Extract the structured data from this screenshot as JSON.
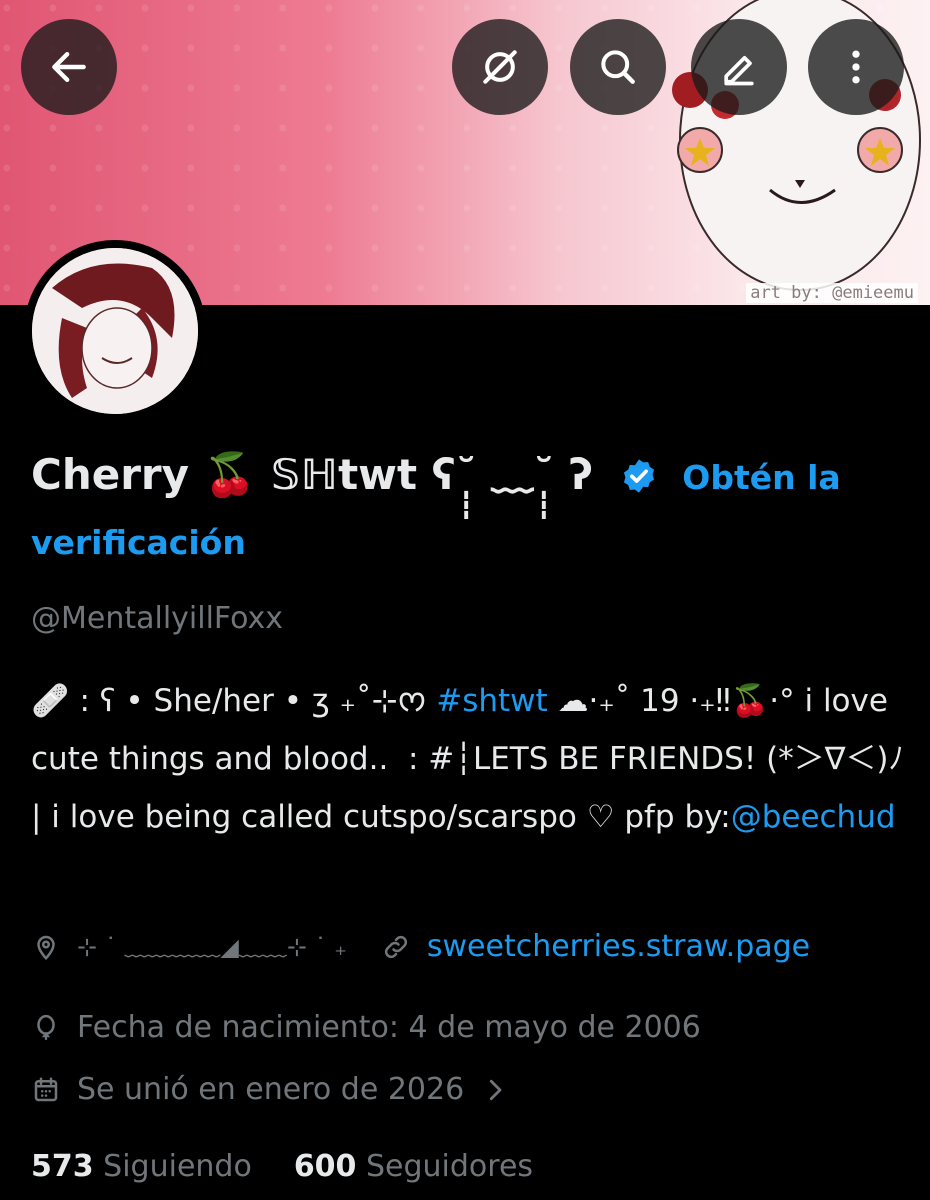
{
  "header": {
    "back_icon": "arrow-left-icon",
    "grok_icon": "slashed-circle-icon",
    "search_icon": "search-icon",
    "edit_icon": "pencil-icon",
    "more_icon": "vertical-ellipsis-icon",
    "banner_credit": "art by: @emieemu"
  },
  "profile": {
    "display_name": "Cherry 🍒 𝕊ℍtwt ʕ˘̩̩̩ ﹏˘̩̩̩ ʔ",
    "verify_cta_part1": "Obtén la",
    "verify_cta_part2": "verificación",
    "handle": "@MentallyillFoxx",
    "bio_part1": "🩹 : ʕ • She/her • ʒ ₊˚⊹ᰔ ",
    "bio_hashtag": "#shtwt",
    "bio_part2": " ☁︎⋅₊˚ 19 ⋅₊‼︎🍒·° i love cute things and blood..  : #┆LETS BE FRIENDS! (*＞∇＜)ﾉ | i love being called cutspo/scarspo ♡ pfp by:",
    "bio_mention": "@beechud",
    "location": "⊹ ˙ ﹏﹏﹏﹏◢﹏﹏⊹ ˙ ₊",
    "website": "sweetcherries.straw.page",
    "birthdate": "Fecha de nacimiento: 4 de mayo de 2006",
    "joined": "Se unió en enero de 2026"
  },
  "stats": {
    "following_count": "573",
    "following_label": "Siguiendo",
    "followers_count": "600",
    "followers_label": "Seguidores"
  },
  "colors": {
    "background": "#000000",
    "primary_text": "#e7e9ea",
    "secondary_text": "#71767b",
    "link": "#1d9bf0",
    "banner_pink": "#e05673"
  }
}
